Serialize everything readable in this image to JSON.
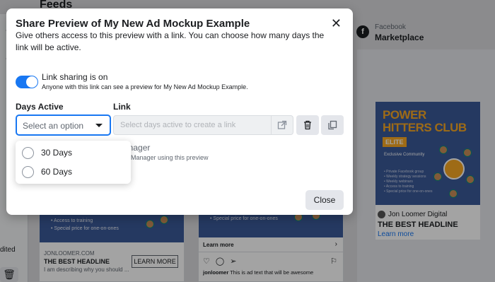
{
  "background": {
    "feeds_header": "Feeds",
    "left_text": "dited",
    "card1": {
      "bullets": [
        "Access to training",
        "Special price for one-on-ones"
      ],
      "site": "JONLOOMER.COM",
      "headline": "THE BEST HEADLINE",
      "description": "I am describing why you should ...",
      "cta": "LEARN MORE"
    },
    "card2": {
      "bullets": [
        "Special price for one-on-ones"
      ],
      "learn_more": "Learn more",
      "caption_user": "jonloomer",
      "caption_text": "This is ad text that will be awesome"
    },
    "marketplace": {
      "platform": "Facebook",
      "placement": "Marketplace",
      "ad_title_line1": "POWER",
      "ad_title_line2": "HITTERS CLUB",
      "ad_badge": "ELITE",
      "ad_tagline": "Exclusive Community",
      "ad_bullets": [
        "Private Facebook group",
        "Weekly strategy sessions",
        "Weekly webinars",
        "Access to training",
        "Special price for one-on-ones"
      ],
      "author": "Jon Loomer Digital",
      "headline": "THE BEST HEADLINE",
      "link": "Learn more"
    }
  },
  "modal": {
    "title": "Share Preview of My New Ad Mockup Example",
    "description": "Give others access to this preview with a link. You can choose how many days the link will be active.",
    "link_sharing_label": "Link sharing is on",
    "link_sharing_sub": "Anyone with this link can see a preview for My New Ad Mockup Example.",
    "days_active_label": "Days Active",
    "link_label": "Link",
    "select_placeholder": "Select an option",
    "link_placeholder": "Select days active to create a link",
    "partial_text_1": "anager",
    "partial_text_2": "Manager using this preview",
    "options": [
      {
        "label": "30 Days"
      },
      {
        "label": "60 Days"
      }
    ],
    "close_label": "Close"
  },
  "colors": {
    "accent": "#1877f2",
    "ad_blue": "#3b5998",
    "ad_orange": "#f7a823"
  }
}
